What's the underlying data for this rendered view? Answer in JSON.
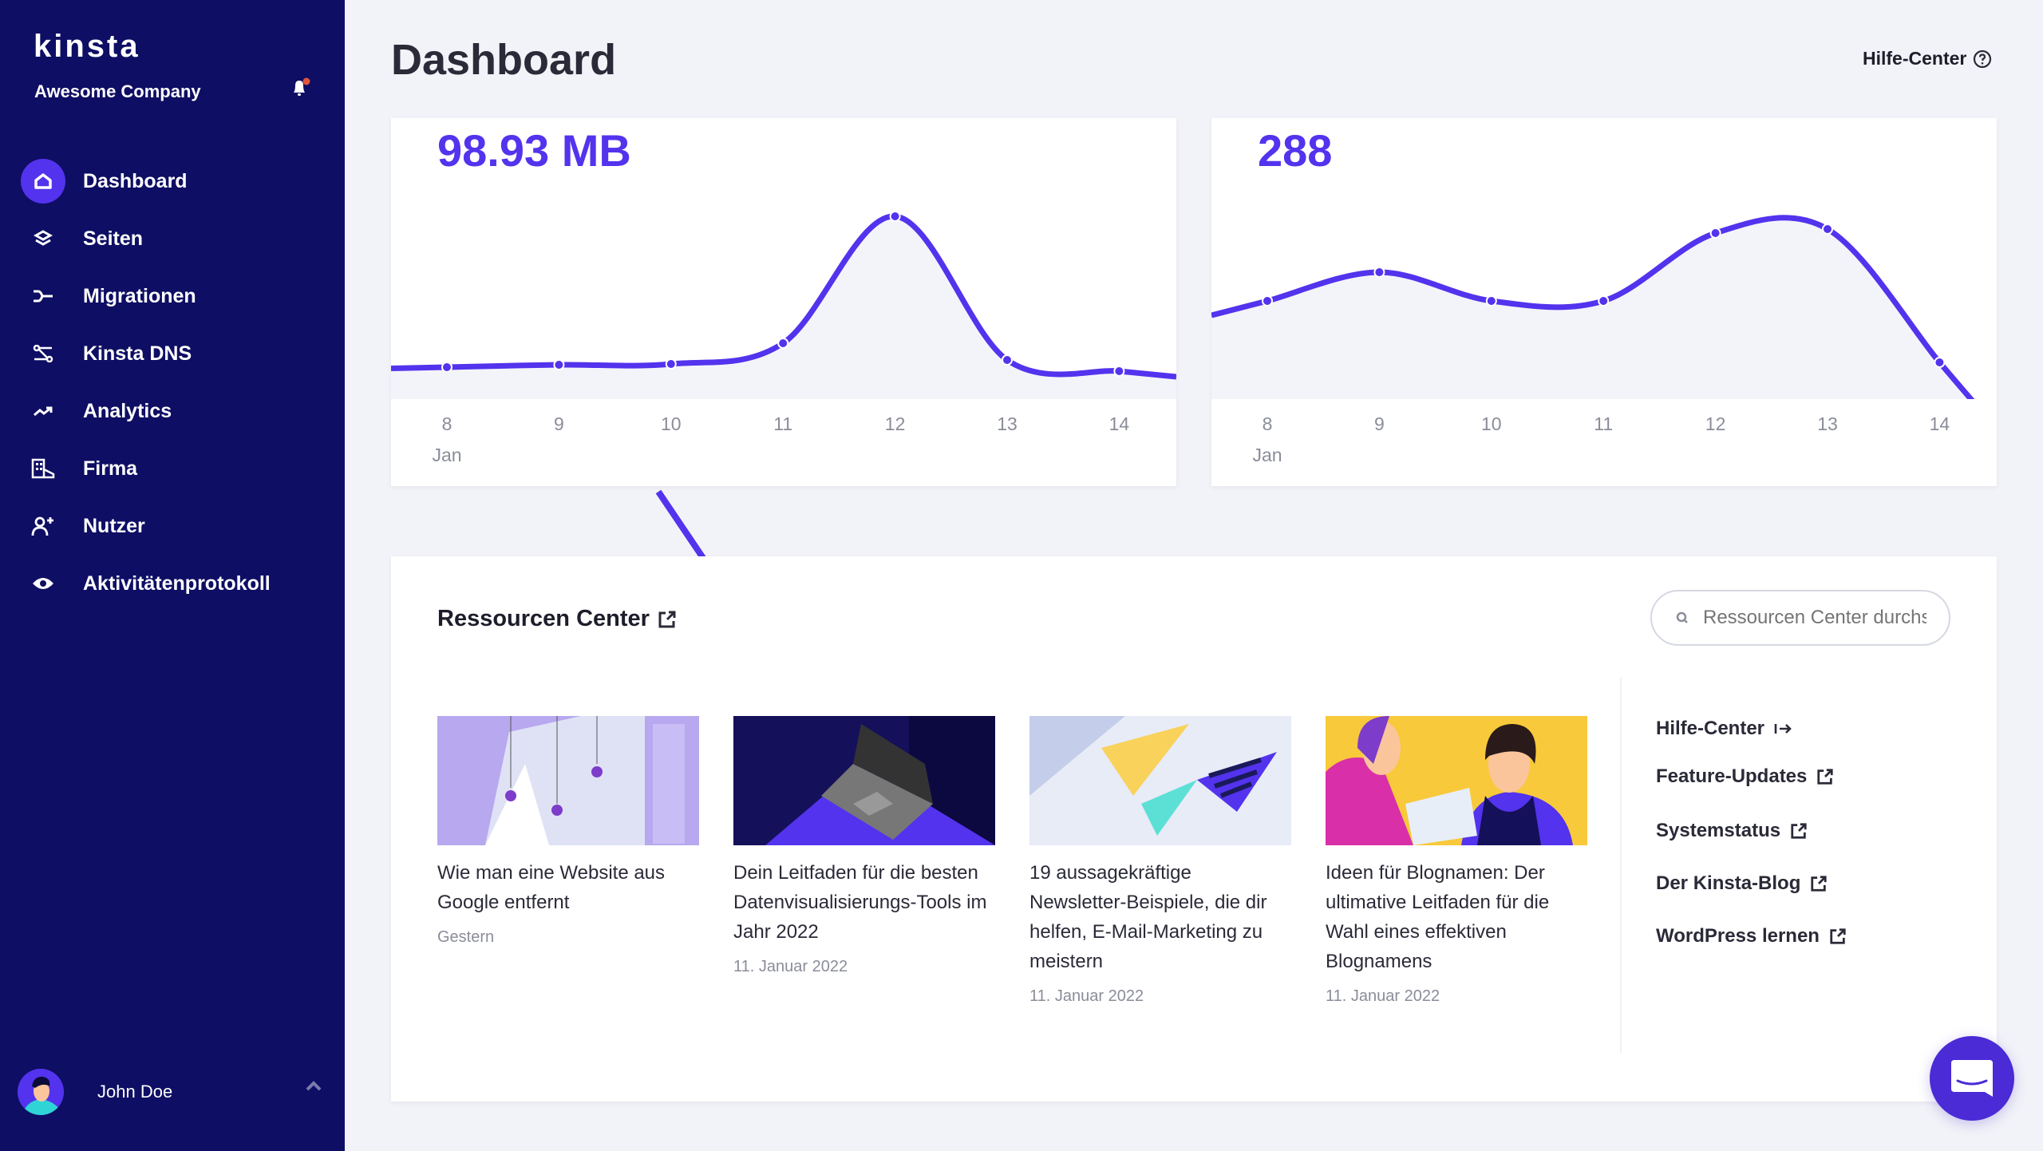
{
  "sidebar": {
    "logo": "kinsta",
    "company": "Awesome Company",
    "notification_badge_color": "#e0563a",
    "items": [
      {
        "label": "Dashboard",
        "icon": "home-icon",
        "active": true
      },
      {
        "label": "Seiten",
        "icon": "layers-icon"
      },
      {
        "label": "Migrationen",
        "icon": "migration-icon"
      },
      {
        "label": "Kinsta DNS",
        "icon": "dns-icon"
      },
      {
        "label": "Analytics",
        "icon": "trend-icon"
      },
      {
        "label": "Firma",
        "icon": "building-icon"
      },
      {
        "label": "Nutzer",
        "icon": "user-add-icon"
      },
      {
        "label": "Aktivitätenprotokoll",
        "icon": "eye-icon"
      }
    ],
    "user": {
      "name": "John Doe"
    }
  },
  "header": {
    "title": "Dashboard",
    "help_label": "Hilfe-Center"
  },
  "colors": {
    "accent": "#5333ed",
    "sidebar": "#0e0e64",
    "fill": "#f3f4f9"
  },
  "chart_data": [
    {
      "type": "line",
      "title": "98.93 MB",
      "categories": [
        "8",
        "9",
        "10",
        "11",
        "12",
        "13",
        "14"
      ],
      "month_label": "Jan",
      "values": [
        40,
        43,
        44,
        70,
        229,
        49,
        35
      ],
      "ylim": [
        0,
        352
      ]
    },
    {
      "type": "line",
      "title": "288",
      "categories": [
        "8",
        "9",
        "10",
        "11",
        "12",
        "13",
        "14"
      ],
      "month_label": "Jan",
      "values": [
        123,
        159,
        123,
        123,
        208,
        213,
        46
      ],
      "ylim": [
        0,
        352
      ]
    }
  ],
  "resources": {
    "title": "Ressourcen Center",
    "search_placeholder": "Ressourcen Center durchsuchen",
    "articles": [
      {
        "title": "Wie man eine Website aus Google entfernt",
        "date": "Gestern"
      },
      {
        "title": "Dein Leitfaden für die besten Datenvisualisierungs-Tools im Jahr 2022",
        "date": "11. Januar 2022"
      },
      {
        "title": "19 aussagekräftige Newsletter-Beispiele, die dir helfen, E-Mail-Marketing zu meistern",
        "date": "11. Januar 2022"
      },
      {
        "title": "Ideen für Blognamen: Der ultimative Leitfaden für die Wahl eines effektiven Blognamens",
        "date": "11. Januar 2022"
      }
    ],
    "links": [
      {
        "label": "Hilfe-Center",
        "icon": "arrow-right-bar-icon"
      },
      {
        "label": "Feature-Updates",
        "icon": "external-link-icon"
      },
      {
        "label": "Systemstatus",
        "icon": "external-link-icon"
      },
      {
        "label": "Der Kinsta-Blog",
        "icon": "external-link-icon"
      },
      {
        "label": "WordPress lernen",
        "icon": "external-link-icon"
      }
    ]
  }
}
